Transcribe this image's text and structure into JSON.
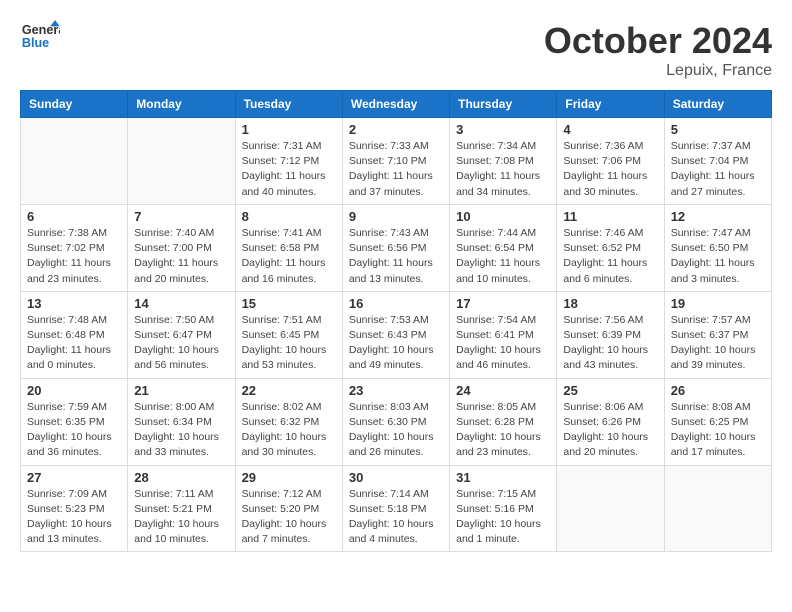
{
  "header": {
    "logo_line1": "General",
    "logo_line2": "Blue",
    "month": "October 2024",
    "location": "Lepuix, France"
  },
  "weekdays": [
    "Sunday",
    "Monday",
    "Tuesday",
    "Wednesday",
    "Thursday",
    "Friday",
    "Saturday"
  ],
  "weeks": [
    [
      {
        "day": "",
        "info": ""
      },
      {
        "day": "",
        "info": ""
      },
      {
        "day": "1",
        "info": "Sunrise: 7:31 AM\nSunset: 7:12 PM\nDaylight: 11 hours\nand 40 minutes."
      },
      {
        "day": "2",
        "info": "Sunrise: 7:33 AM\nSunset: 7:10 PM\nDaylight: 11 hours\nand 37 minutes."
      },
      {
        "day": "3",
        "info": "Sunrise: 7:34 AM\nSunset: 7:08 PM\nDaylight: 11 hours\nand 34 minutes."
      },
      {
        "day": "4",
        "info": "Sunrise: 7:36 AM\nSunset: 7:06 PM\nDaylight: 11 hours\nand 30 minutes."
      },
      {
        "day": "5",
        "info": "Sunrise: 7:37 AM\nSunset: 7:04 PM\nDaylight: 11 hours\nand 27 minutes."
      }
    ],
    [
      {
        "day": "6",
        "info": "Sunrise: 7:38 AM\nSunset: 7:02 PM\nDaylight: 11 hours\nand 23 minutes."
      },
      {
        "day": "7",
        "info": "Sunrise: 7:40 AM\nSunset: 7:00 PM\nDaylight: 11 hours\nand 20 minutes."
      },
      {
        "day": "8",
        "info": "Sunrise: 7:41 AM\nSunset: 6:58 PM\nDaylight: 11 hours\nand 16 minutes."
      },
      {
        "day": "9",
        "info": "Sunrise: 7:43 AM\nSunset: 6:56 PM\nDaylight: 11 hours\nand 13 minutes."
      },
      {
        "day": "10",
        "info": "Sunrise: 7:44 AM\nSunset: 6:54 PM\nDaylight: 11 hours\nand 10 minutes."
      },
      {
        "day": "11",
        "info": "Sunrise: 7:46 AM\nSunset: 6:52 PM\nDaylight: 11 hours\nand 6 minutes."
      },
      {
        "day": "12",
        "info": "Sunrise: 7:47 AM\nSunset: 6:50 PM\nDaylight: 11 hours\nand 3 minutes."
      }
    ],
    [
      {
        "day": "13",
        "info": "Sunrise: 7:48 AM\nSunset: 6:48 PM\nDaylight: 11 hours\nand 0 minutes."
      },
      {
        "day": "14",
        "info": "Sunrise: 7:50 AM\nSunset: 6:47 PM\nDaylight: 10 hours\nand 56 minutes."
      },
      {
        "day": "15",
        "info": "Sunrise: 7:51 AM\nSunset: 6:45 PM\nDaylight: 10 hours\nand 53 minutes."
      },
      {
        "day": "16",
        "info": "Sunrise: 7:53 AM\nSunset: 6:43 PM\nDaylight: 10 hours\nand 49 minutes."
      },
      {
        "day": "17",
        "info": "Sunrise: 7:54 AM\nSunset: 6:41 PM\nDaylight: 10 hours\nand 46 minutes."
      },
      {
        "day": "18",
        "info": "Sunrise: 7:56 AM\nSunset: 6:39 PM\nDaylight: 10 hours\nand 43 minutes."
      },
      {
        "day": "19",
        "info": "Sunrise: 7:57 AM\nSunset: 6:37 PM\nDaylight: 10 hours\nand 39 minutes."
      }
    ],
    [
      {
        "day": "20",
        "info": "Sunrise: 7:59 AM\nSunset: 6:35 PM\nDaylight: 10 hours\nand 36 minutes."
      },
      {
        "day": "21",
        "info": "Sunrise: 8:00 AM\nSunset: 6:34 PM\nDaylight: 10 hours\nand 33 minutes."
      },
      {
        "day": "22",
        "info": "Sunrise: 8:02 AM\nSunset: 6:32 PM\nDaylight: 10 hours\nand 30 minutes."
      },
      {
        "day": "23",
        "info": "Sunrise: 8:03 AM\nSunset: 6:30 PM\nDaylight: 10 hours\nand 26 minutes."
      },
      {
        "day": "24",
        "info": "Sunrise: 8:05 AM\nSunset: 6:28 PM\nDaylight: 10 hours\nand 23 minutes."
      },
      {
        "day": "25",
        "info": "Sunrise: 8:06 AM\nSunset: 6:26 PM\nDaylight: 10 hours\nand 20 minutes."
      },
      {
        "day": "26",
        "info": "Sunrise: 8:08 AM\nSunset: 6:25 PM\nDaylight: 10 hours\nand 17 minutes."
      }
    ],
    [
      {
        "day": "27",
        "info": "Sunrise: 7:09 AM\nSunset: 5:23 PM\nDaylight: 10 hours\nand 13 minutes."
      },
      {
        "day": "28",
        "info": "Sunrise: 7:11 AM\nSunset: 5:21 PM\nDaylight: 10 hours\nand 10 minutes."
      },
      {
        "day": "29",
        "info": "Sunrise: 7:12 AM\nSunset: 5:20 PM\nDaylight: 10 hours\nand 7 minutes."
      },
      {
        "day": "30",
        "info": "Sunrise: 7:14 AM\nSunset: 5:18 PM\nDaylight: 10 hours\nand 4 minutes."
      },
      {
        "day": "31",
        "info": "Sunrise: 7:15 AM\nSunset: 5:16 PM\nDaylight: 10 hours\nand 1 minute."
      },
      {
        "day": "",
        "info": ""
      },
      {
        "day": "",
        "info": ""
      }
    ]
  ]
}
